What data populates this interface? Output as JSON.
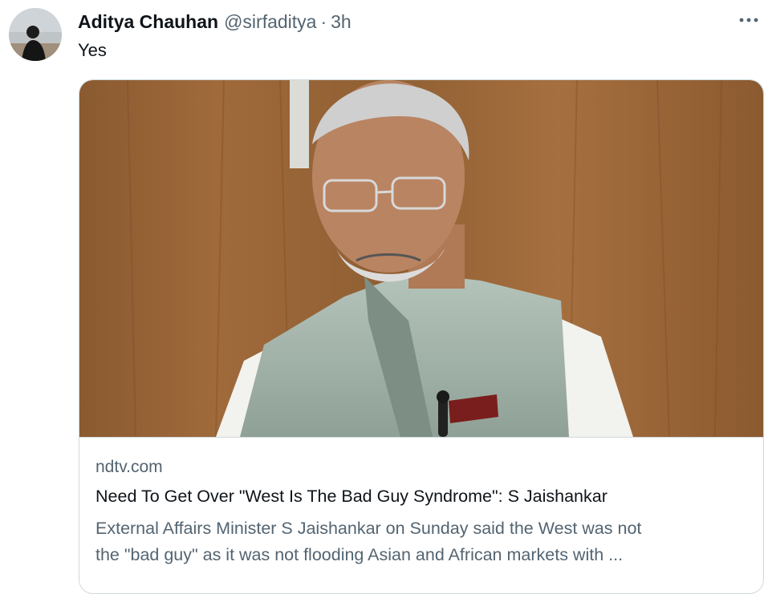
{
  "tweet": {
    "author_name": "Aditya Chauhan",
    "author_handle": "@sirfaditya",
    "separator": "·",
    "time": "3h",
    "text": "Yes",
    "more_icon": "more-horizontal-icon"
  },
  "card": {
    "domain": "ndtv.com",
    "title": "Need To Get Over \"West Is The Bad Guy Syndrome\": S Jaishankar",
    "description_line1": "External Affairs Minister S Jaishankar on Sunday said the West was not",
    "description_line2": "the \"bad guy\" as it was not flooding Asian and African markets with ..."
  },
  "colors": {
    "text_primary": "#0f1419",
    "text_secondary": "#536471",
    "border": "#cfd9de"
  }
}
